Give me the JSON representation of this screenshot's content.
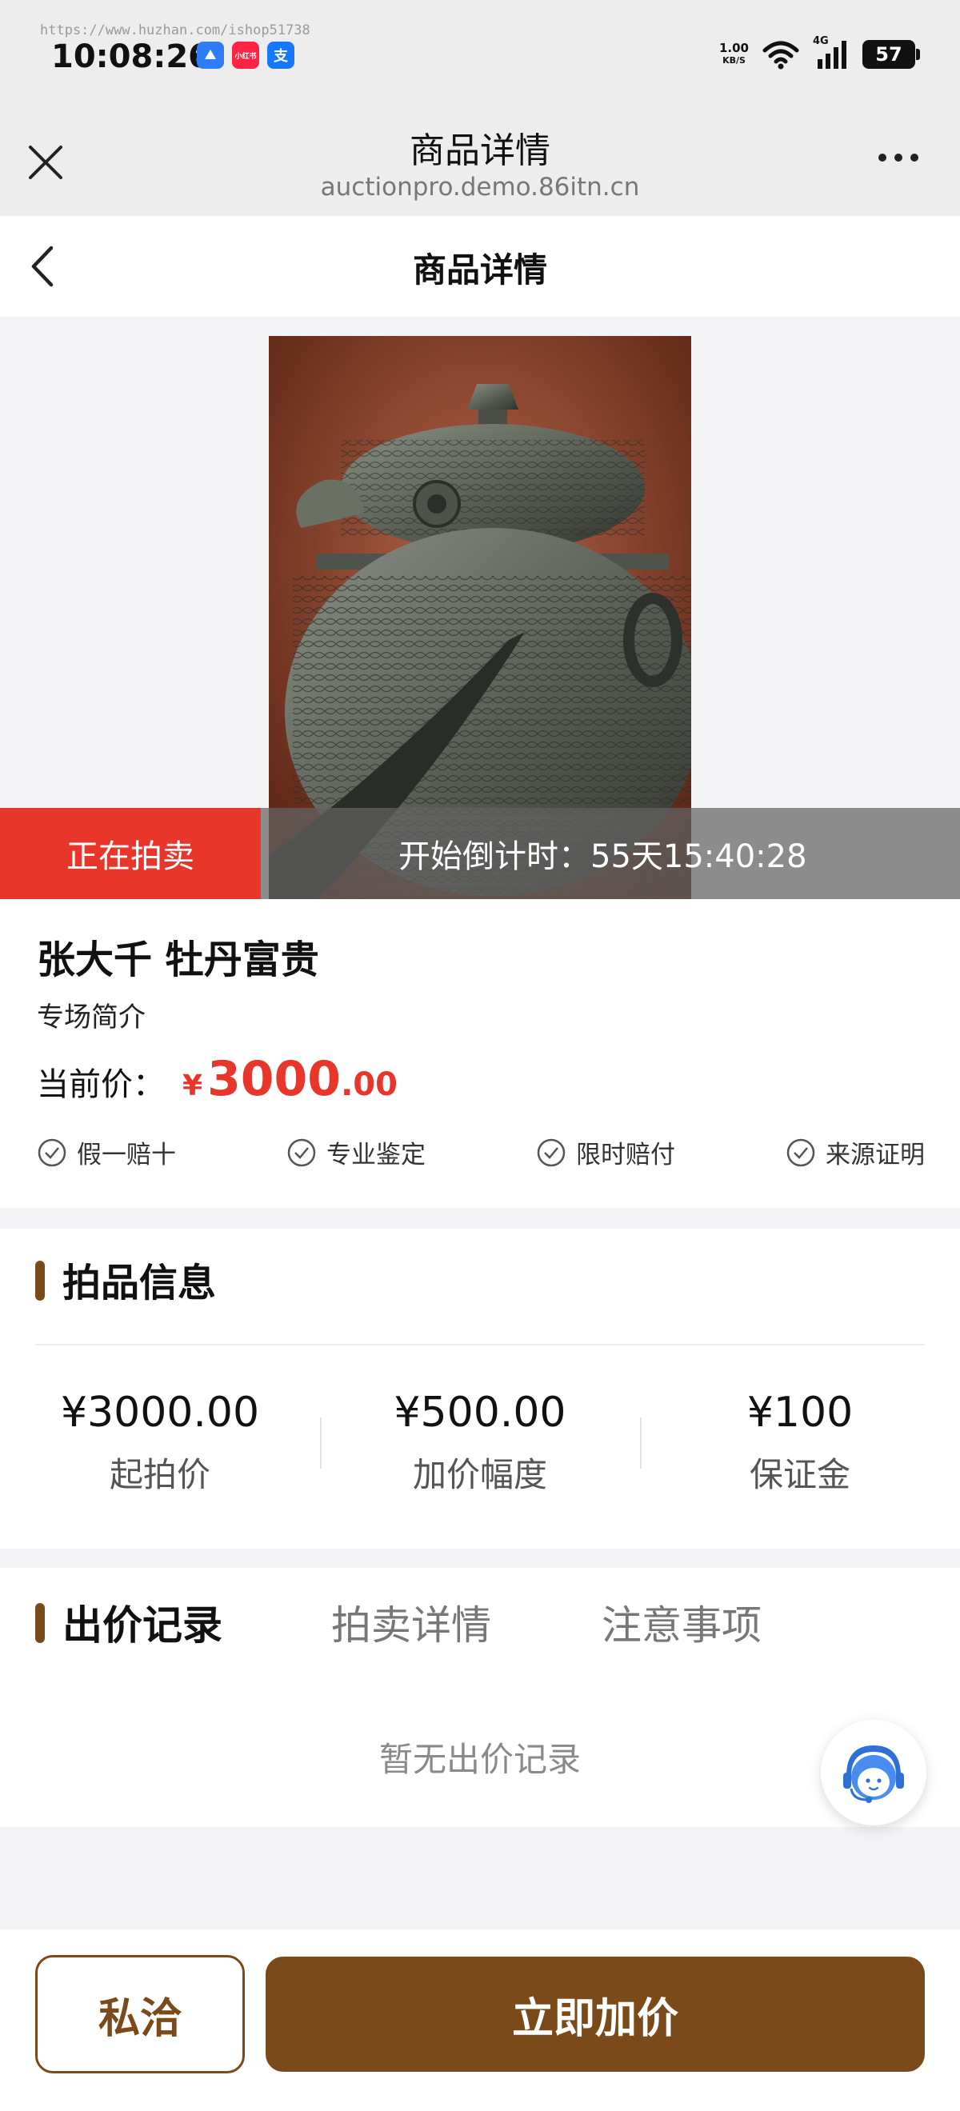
{
  "status_bar": {
    "watermark": "https://www.huzhan.com/ishop51738",
    "time": "10:08:26",
    "net_speed_value": "1.00",
    "net_speed_unit": "KB/S",
    "network_type": "4G",
    "battery": "57",
    "app_icons": [
      {
        "name": "blue-app-icon",
        "color": "#2f7df6",
        "label": ""
      },
      {
        "name": "xiaohongshu-icon",
        "color": "#ff2442",
        "label": "小红书"
      },
      {
        "name": "alipay-icon",
        "color": "#1677ff",
        "label": "支"
      }
    ]
  },
  "webview": {
    "title": "商品详情",
    "url": "auctionpro.demo.86itn.cn"
  },
  "page": {
    "title": "商品详情"
  },
  "auction": {
    "status_label": "正在拍卖",
    "countdown": "开始倒计时：55天15:40:28"
  },
  "product": {
    "name": "张大千 牡丹富贵",
    "intro": "专场简介",
    "price_label": "当前价：",
    "price_symbol": "¥",
    "price_integer": "3000",
    "price_decimal": ".00",
    "guarantees": [
      "假一赔十",
      "专业鉴定",
      "限时赔付",
      "来源证明"
    ]
  },
  "lot_info": {
    "title": "拍品信息",
    "stats": [
      {
        "value": "¥3000.00",
        "label": "起拍价"
      },
      {
        "value": "¥500.00",
        "label": "加价幅度"
      },
      {
        "value": "¥100",
        "label": "保证金"
      }
    ]
  },
  "tabs": {
    "items": [
      "出价记录",
      "拍卖详情",
      "注意事项"
    ],
    "active_index": 0,
    "empty_text": "暂无出价记录"
  },
  "actions": {
    "private_label": "私洽",
    "bid_label": "立即加价"
  },
  "colors": {
    "accent_brown": "#7b4a1a",
    "price_red": "#e8362b"
  }
}
